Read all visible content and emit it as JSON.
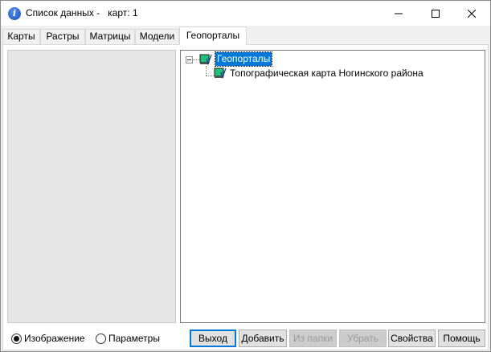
{
  "window": {
    "title": "Список данных -   карт: 1"
  },
  "tabs": [
    {
      "label": "Карты"
    },
    {
      "label": "Растры"
    },
    {
      "label": "Матрицы"
    },
    {
      "label": "Модели"
    },
    {
      "label": "Геопорталы",
      "active": true
    }
  ],
  "tree": {
    "root": {
      "label": "Геопорталы"
    },
    "children": [
      {
        "label": "Топографическая карта Ногинского района"
      }
    ]
  },
  "view_mode": {
    "options": [
      {
        "label": "Изображение",
        "selected": true
      },
      {
        "label": "Параметры",
        "selected": false
      }
    ]
  },
  "buttons": {
    "exit": "Выход",
    "add": "Добавить",
    "from_folder": "Из папки",
    "remove": "Убрать",
    "properties": "Свойства",
    "help": "Помощь"
  },
  "colors": {
    "selection": "#0078d7",
    "node_icon": "#22c07a"
  },
  "icons": {
    "app": "info-icon",
    "tree_node": "map-layer-icon"
  }
}
